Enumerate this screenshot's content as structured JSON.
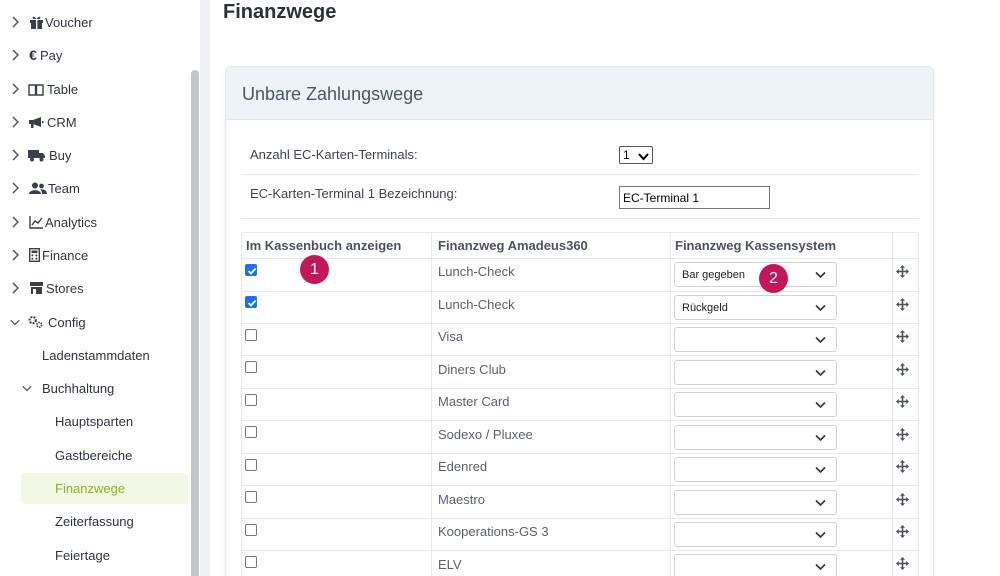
{
  "sidebar": {
    "items": [
      {
        "label": "Voucher",
        "icon": "gift-icon"
      },
      {
        "label": "Pay",
        "icon": "euro-icon"
      },
      {
        "label": "Table",
        "icon": "book-icon"
      },
      {
        "label": "CRM",
        "icon": "megaphone-icon"
      },
      {
        "label": "Buy",
        "icon": "truck-icon"
      },
      {
        "label": "Team",
        "icon": "users-icon"
      },
      {
        "label": "Analytics",
        "icon": "analytics-icon"
      },
      {
        "label": "Finance",
        "icon": "calculator-icon"
      },
      {
        "label": "Stores",
        "icon": "store-icon"
      },
      {
        "label": "Config",
        "icon": "cogs-icon"
      }
    ],
    "config_children": {
      "ladenstammdaten": "Ladenstammdaten",
      "buchhaltung": "Buchhaltung",
      "buchhaltung_children": [
        "Hauptsparten",
        "Gastbereiche",
        "Finanzwege",
        "Zeiterfassung",
        "Feiertage"
      ]
    },
    "active_item": "Finanzwege",
    "active_color": "#8cb31f"
  },
  "page": {
    "title": "Finanzwege"
  },
  "card": {
    "title": "Unbare Zahlungswege",
    "terminals_label": "Anzahl EC-Karten-Terminals:",
    "terminals_value": "1",
    "terminal_name_label": "EC-Karten-Terminal 1 Bezeichnung:",
    "terminal_name_value": "EC-Terminal 1"
  },
  "table": {
    "headers": [
      "Im Kassenbuch anzeigen",
      "Finanzweg Amadeus360",
      "Finanzweg Kassensystem"
    ],
    "rows": [
      {
        "checked": true,
        "name": "Lunch-Check",
        "kassensystem": "Bar gegeben"
      },
      {
        "checked": true,
        "name": "Lunch-Check",
        "kassensystem": "Rückgeld"
      },
      {
        "checked": false,
        "name": "Visa",
        "kassensystem": ""
      },
      {
        "checked": false,
        "name": "Diners Club",
        "kassensystem": ""
      },
      {
        "checked": false,
        "name": "Master Card",
        "kassensystem": ""
      },
      {
        "checked": false,
        "name": "Sodexo / Pluxee",
        "kassensystem": ""
      },
      {
        "checked": false,
        "name": "Edenred",
        "kassensystem": ""
      },
      {
        "checked": false,
        "name": "Maestro",
        "kassensystem": ""
      },
      {
        "checked": false,
        "name": "Kooperations-GS 3",
        "kassensystem": ""
      },
      {
        "checked": false,
        "name": "ELV",
        "kassensystem": ""
      }
    ]
  },
  "badges": [
    "1",
    "2"
  ],
  "colors": {
    "checkbox": "#1a73e8",
    "badge": "#c2185b",
    "card_header": "#eef3f8"
  }
}
